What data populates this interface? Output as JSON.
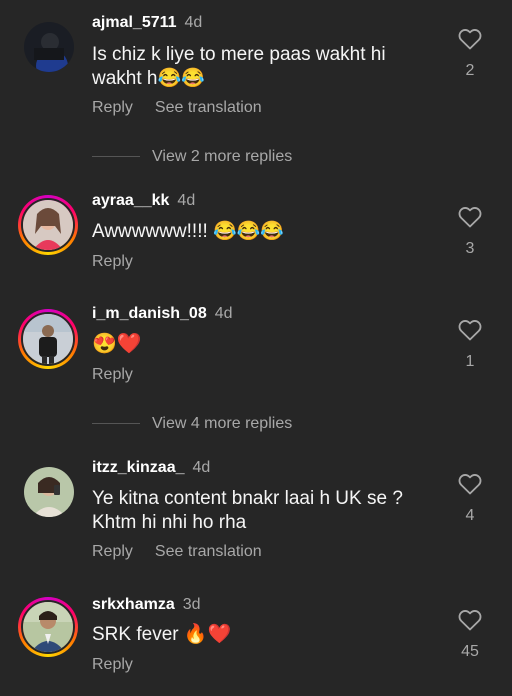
{
  "comments": [
    {
      "user": "ajmal_5711",
      "time": "4d",
      "text": "Is chiz k liye to mere paas wakht hi wakht h😂😂",
      "reply": "Reply",
      "translate": "See translation",
      "likes": "2"
    },
    {
      "user": "ayraa__kk",
      "time": "4d",
      "text": "Awwwwww!!!! 😂😂😂",
      "reply": "Reply",
      "likes": "3"
    },
    {
      "user": "i_m_danish_08",
      "time": "4d",
      "text": "😍❤️",
      "reply": "Reply",
      "likes": "1"
    },
    {
      "user": "itzz_kinzaa_",
      "time": "4d",
      "text": "Ye kitna content bnakr laai h UK se ? Khtm hi nhi ho rha",
      "reply": "Reply",
      "translate": "See translation",
      "likes": "4"
    },
    {
      "user": "srkxhamza",
      "time": "3d",
      "text": "SRK fever 🔥❤️",
      "reply": "Reply",
      "likes": "45"
    }
  ],
  "more_replies_1": "View 2 more replies",
  "more_replies_2": "View 4 more replies",
  "colors": {
    "background": "#262626",
    "secondary_text": "#a8a8a8",
    "primary_text": "#f5f5f5"
  }
}
